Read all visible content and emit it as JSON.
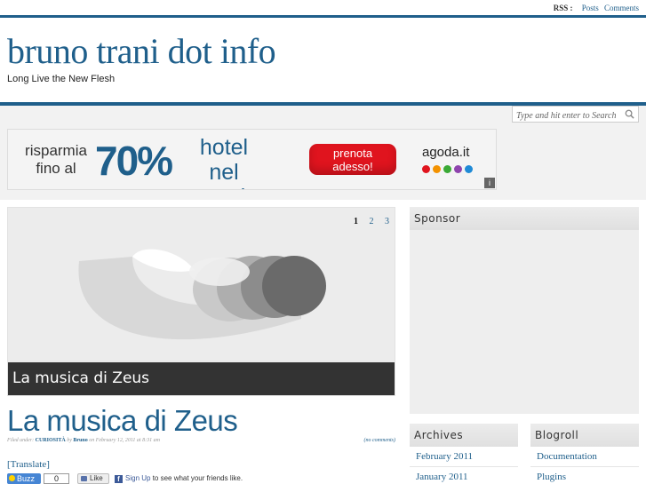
{
  "topbar": {
    "rss_label": "RSS :",
    "links": [
      "Posts",
      "Comments"
    ]
  },
  "header": {
    "title": "bruno trani dot info",
    "tagline": "Long Live the New Flesh"
  },
  "search": {
    "placeholder": "Type and hit enter to Search",
    "icon": "magnifier-icon"
  },
  "banner": {
    "line1a": "risparmia",
    "line1b": "fino al",
    "percent": "70%",
    "line2a": "hotel",
    "line2b": "nel mondo",
    "cta_a": "prenota",
    "cta_b": "adesso!",
    "brand": "agoda.it",
    "dot_colors": [
      "#e0141e",
      "#f39200",
      "#3aa935",
      "#8e44ad",
      "#1f8ad6"
    ],
    "info": "i"
  },
  "slider": {
    "pages": [
      "1",
      "2",
      "3"
    ],
    "active_page": "1",
    "caption": "La musica di Zeus"
  },
  "post": {
    "title": "La musica di Zeus",
    "filed_under_label": "Filed under:",
    "category": "CURIOSITÀ",
    "by_label": "by",
    "author": "Bruno",
    "date_text": "on February 12, 2011 at 8:31 am",
    "comments": "(no comments)",
    "translate": "[Translate]"
  },
  "social": {
    "buzz_label": "Buzz",
    "buzz_count": "0",
    "like_label": "Like",
    "fb_link": "Sign Up",
    "fb_text": " to see what your friends like."
  },
  "sidebar": {
    "sponsor_title": "Sponsor",
    "archives_title": "Archives",
    "archives": [
      "February 2011",
      "January 2011"
    ],
    "blogroll_title": "Blogroll",
    "blogroll": [
      "Documentation",
      "Plugins"
    ]
  }
}
